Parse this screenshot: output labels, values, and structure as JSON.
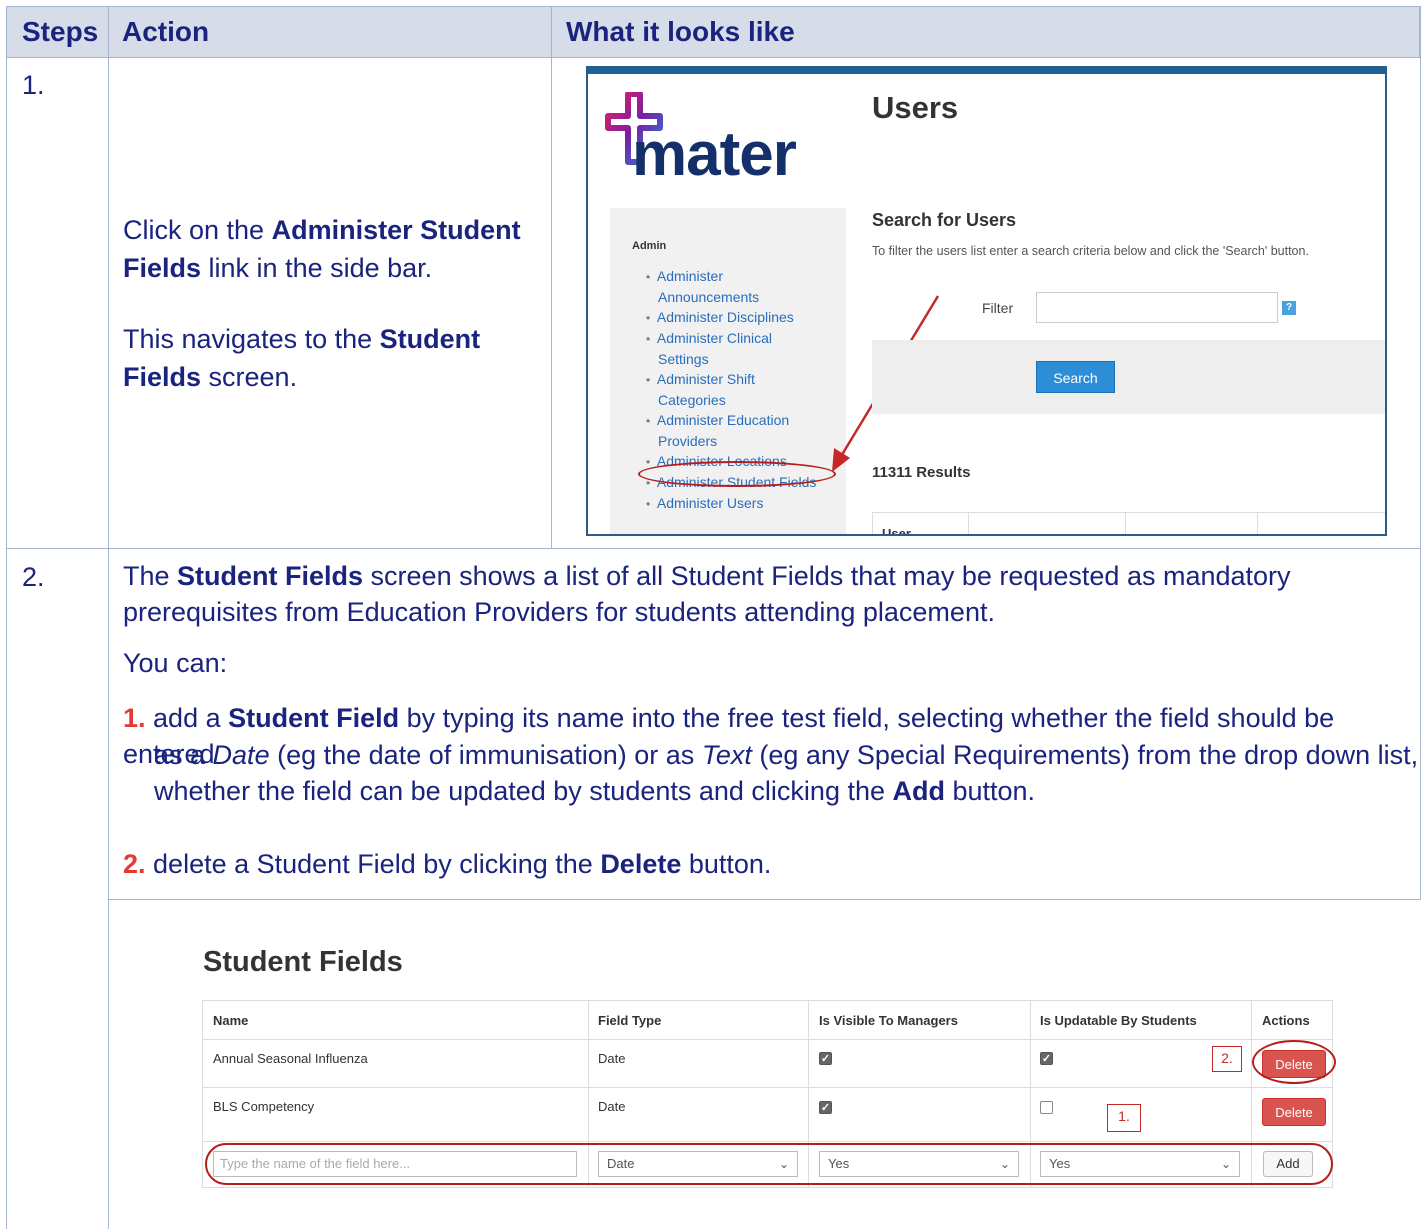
{
  "table": {
    "headers": {
      "steps": "Steps",
      "action": "Action",
      "looks": "What it looks like"
    },
    "step1": {
      "num": "1.",
      "p1_a": "Click on the ",
      "p1_b": "Administer Student",
      "p1_c": "Fields",
      "p1_d": " link in the side bar.",
      "p2_a": "This navigates to the ",
      "p2_b": "Student",
      "p2_c": "Fields",
      "p2_d": " screen."
    },
    "step2": {
      "num": "2.",
      "intro_a": "The ",
      "intro_b": "Student Fields",
      "intro_c": " screen shows a list of all Student Fields that may be requested as mandatory",
      "intro_d": "prerequisites from Education Providers for students attending placement.",
      "you_can": "You can:",
      "item1_num": "1.",
      "item1_a": " add a ",
      "item1_b": "Student Field",
      "item1_c": " by typing its name into the free test field, selecting whether the field should be entered",
      "item1_d": "as a ",
      "item1_e": "Date",
      "item1_f": " (eg the date of immunisation) or as ",
      "item1_g": "Text",
      "item1_h": " (eg any Special Requirements) from the drop down list,",
      "item1_i": "whether the field can be updated by students and clicking the ",
      "item1_j": "Add",
      "item1_k": " button.",
      "item2_num": "2.",
      "item2_a": " delete a Student Field by clicking the ",
      "item2_b": "Delete",
      "item2_c": " button."
    }
  },
  "shot1": {
    "logo_text": "mater",
    "page_title": "Users",
    "sidebar_heading": "Admin",
    "sidebar_items": [
      "Administer",
      "Announcements",
      "Administer Disciplines",
      "Administer Clinical",
      "Settings",
      "Administer Shift",
      "Categories",
      "Administer Education",
      "Providers",
      "Administer Locations",
      "Administer Student Fields",
      "Administer Users"
    ],
    "search_heading": "Search for Users",
    "search_help": "To filter the users list enter a search criteria below and click the 'Search' button.",
    "filter_label": "Filter",
    "help_badge": "?",
    "search_button": "Search",
    "results": "11311 Results",
    "table_first_col": "User"
  },
  "shot2": {
    "title": "Student Fields",
    "columns": [
      "Name",
      "Field Type",
      "Is Visible To Managers",
      "Is Updatable By Students",
      "Actions"
    ],
    "rows": [
      {
        "name": "Annual Seasonal Influenza",
        "type": "Date",
        "visible": true,
        "updatable": true,
        "action": "Delete"
      },
      {
        "name": "BLS Competency",
        "type": "Date",
        "visible": true,
        "updatable": false,
        "action": "Delete"
      }
    ],
    "new_row": {
      "name_placeholder": "Type the name of the field here...",
      "type": "Date",
      "visible": "Yes",
      "updatable": "Yes",
      "add": "Add"
    },
    "callout1": "1.",
    "callout2": "2."
  },
  "colors": {
    "heading_blue": "#1a237e",
    "accent_red": "#e53935",
    "header_bg": "#d6dde8",
    "link_blue": "#2a6ebb",
    "delete_red": "#d9534f"
  }
}
